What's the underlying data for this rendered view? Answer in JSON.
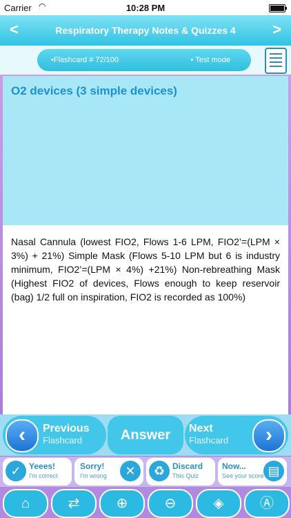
{
  "status": {
    "carrier": "Carrier",
    "time": "10:28 PM"
  },
  "nav": {
    "title": "Respiratory Therapy Notes & Quizzes 4",
    "back": "<",
    "forward": ">"
  },
  "header": {
    "flashcard": "•Flashcard #  72/100",
    "mode": "• Test mode"
  },
  "question": "O2 devices (3 simple devices)",
  "answer": "Nasal Cannula (lowest FIO2, Flows 1-6 LPM, FIO2’=(LPM × 3%) + 21%) Simple Mask (Flows 5-10 LPM but 6 is industry minimum, FIO2’=(LPM × 4%) +21%) Non-rebreathing Mask (Highest FIO2 of devices, Flows enough to keep reservoir (bag) 1/2 full on inspiration, FIO2 is recorded as 100%)",
  "buttons": {
    "previous": {
      "l1": "Previous",
      "l2": "Flashcard"
    },
    "answer": "Answer",
    "next": {
      "l1": "Next",
      "l2": "Flashcard"
    }
  },
  "small": [
    {
      "t1": "Yeees!",
      "t2": "I'm correct",
      "icon": "check-icon"
    },
    {
      "t1": "Sorry!",
      "t2": "I'm wrong",
      "icon": "cross-icon"
    },
    {
      "t1": "Discard",
      "t2": "This Quiz",
      "icon": "recycle-icon"
    },
    {
      "t1": "Now...",
      "t2": "See your score",
      "icon": "chart-icon"
    }
  ],
  "icons": [
    "home-icon",
    "share-icon",
    "zoom-in-icon",
    "zoom-out-icon",
    "tag-icon",
    "font-icon"
  ],
  "colors": {
    "accent": "#31c3e4",
    "question_text": "#1e90d5"
  }
}
